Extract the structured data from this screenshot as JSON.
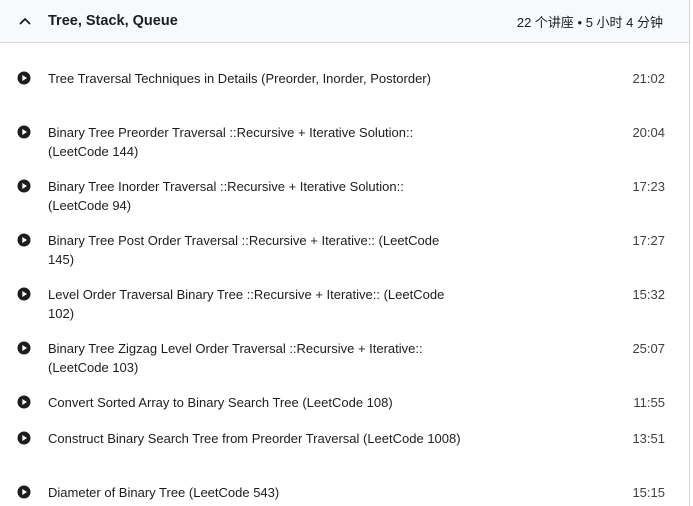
{
  "section": {
    "title": "Tree, Stack, Queue",
    "meta": "22 个讲座 • 5 小时 4 分钟",
    "chevron_icon": "chevron-up-icon"
  },
  "lectures": [
    {
      "title": "Tree Traversal Techniques in Details (Preorder, Inorder, Postorder)",
      "duration": "21:02",
      "icon": "play-circle-icon"
    },
    {
      "title": "Binary Tree Preorder Traversal ::Recursive + Iterative Solution:: (LeetCode 144)",
      "duration": "20:04",
      "icon": "play-circle-icon"
    },
    {
      "title": "Binary Tree Inorder Traversal ::Recursive + Iterative Solution:: (LeetCode 94)",
      "duration": "17:23",
      "icon": "play-circle-icon"
    },
    {
      "title": "Binary Tree Post Order Traversal ::Recursive + Iterative:: (LeetCode 145)",
      "duration": "17:27",
      "icon": "play-circle-icon"
    },
    {
      "title": "Level Order Traversal Binary Tree ::Recursive + Iterative:: (LeetCode 102)",
      "duration": "15:32",
      "icon": "play-circle-icon"
    },
    {
      "title": "Binary Tree Zigzag Level Order Traversal ::Recursive + Iterative:: (LeetCode 103)",
      "duration": "25:07",
      "icon": "play-circle-icon"
    },
    {
      "title": "Convert Sorted Array to Binary Search Tree (LeetCode 108)",
      "duration": "11:55",
      "icon": "play-circle-icon"
    },
    {
      "title": "Construct Binary Search Tree from Preorder Traversal (LeetCode 1008)",
      "duration": "13:51",
      "icon": "play-circle-icon"
    },
    {
      "title": "Diameter of Binary Tree (LeetCode 543)",
      "duration": "15:15",
      "icon": "play-circle-icon"
    }
  ]
}
